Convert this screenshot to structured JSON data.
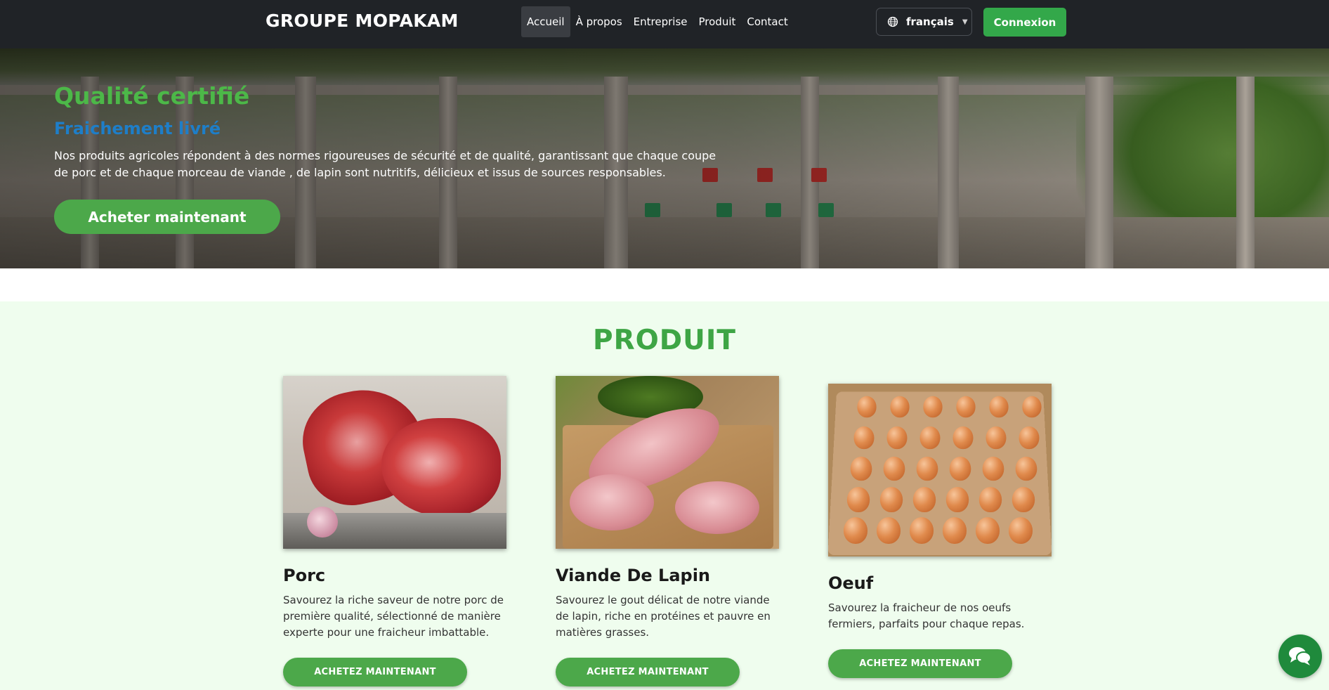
{
  "navbar": {
    "brand": "GROUPE MOPAKAM",
    "links": [
      "Accueil",
      "À propos",
      "Entreprise",
      "Produit",
      "Contact"
    ],
    "active_link": "Accueil",
    "language": {
      "label": "français",
      "icon": "globe-icon"
    },
    "login_label": "Connexion"
  },
  "hero": {
    "title": "Qualité certifié",
    "subtitle": "Fraichement livré",
    "text": "Nos produits agricoles répondent à des normes rigoureuses de sécurité et de qualité, garantissant que chaque coupe de porc et de chaque morceau de viande , de lapin sont nutritifs, délicieux et issus de sources responsables.",
    "cta_label": "Acheter maintenant"
  },
  "products": {
    "title": "PRODUIT",
    "items": [
      {
        "name": "Porc",
        "description": "Savourez la riche saveur de notre porc de première qualité, sélectionné de manière experte pour une fraicheur imbattable.",
        "button": "ACHETEZ MAINTENANT"
      },
      {
        "name": "Viande De Lapin",
        "description": "Savourez le gout délicat de notre viande de lapin, riche en protéines et pauvre en matières grasses.",
        "button": "ACHETEZ MAINTENANT"
      },
      {
        "name": "Oeuf",
        "description": "Savourez la fraicheur de nos oeufs fermiers, parfaits pour chaque repas.",
        "button": "ACHETEZ MAINTENANT"
      }
    ]
  },
  "chat": {
    "icon": "chat-icon"
  },
  "colors": {
    "navbar_bg": "#202327",
    "accent_green": "#4ca84a",
    "hero_title": "#4cb848",
    "hero_subtitle": "#1e7ec8",
    "section_bg": "#effdee",
    "section_title": "#3ea545"
  }
}
